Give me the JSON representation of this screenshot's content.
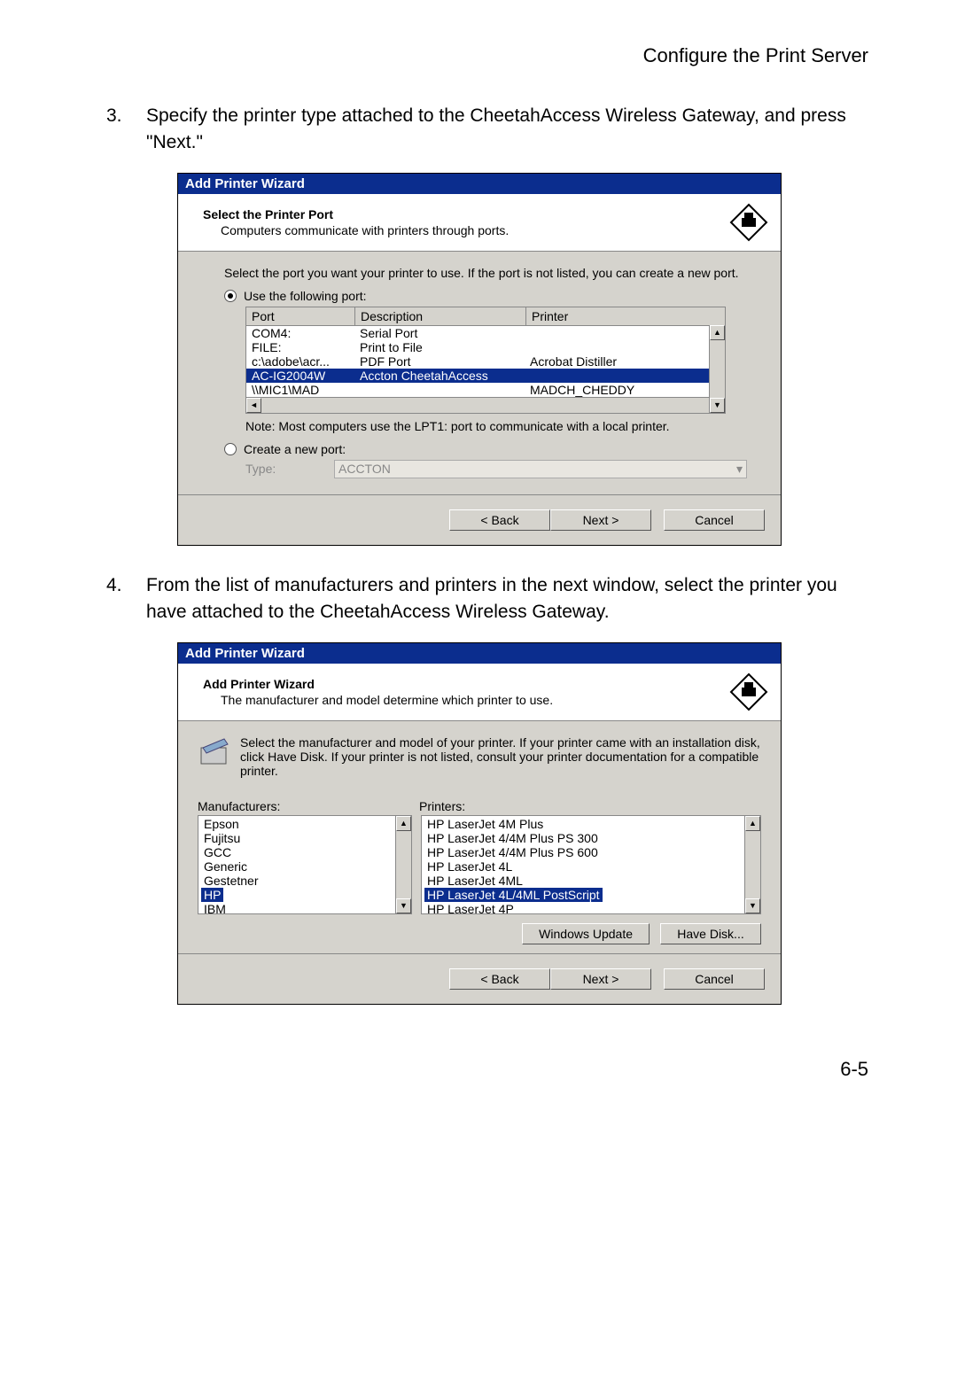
{
  "header": "Configure the Print Server",
  "pageNumber": "6-5",
  "step3": {
    "num": "3.",
    "text": "Specify the printer type attached to the CheetahAccess Wireless Gateway, and press \"Next.\""
  },
  "step4": {
    "num": "4.",
    "text": "From the list of manufacturers and printers in the next window, select the printer you have attached to the CheetahAccess Wireless Gateway."
  },
  "wizard1": {
    "title": "Add Printer Wizard",
    "headTitle": "Select the Printer Port",
    "headSub": "Computers communicate with printers through ports.",
    "intro": "Select the port you want your printer to use.  If the port is not listed, you can create a new port.",
    "radioUse": "Use the following port:",
    "radioCreate": "Create a new port:",
    "cols": {
      "port": "Port",
      "desc": "Description",
      "printer": "Printer"
    },
    "rows": [
      {
        "port": "COM4:",
        "desc": "Serial Port",
        "printer": ""
      },
      {
        "port": "FILE:",
        "desc": "Print to File",
        "printer": ""
      },
      {
        "port": "c:\\adobe\\acr...",
        "desc": "PDF Port",
        "printer": "Acrobat Distiller"
      },
      {
        "port": "AC-IG2004W",
        "desc": "Accton CheetahAccess",
        "printer": "",
        "selected": true
      },
      {
        "port": "\\\\MIC1\\MAD",
        "desc": "",
        "printer": "MADCH_CHEDDY"
      }
    ],
    "note": "Note: Most computers use the LPT1: port to communicate with a local printer.",
    "typeLabel": "Type:",
    "typeValue": "ACCTON",
    "back": "< Back",
    "next": "Next >",
    "cancel": "Cancel"
  },
  "wizard2": {
    "title": "Add Printer Wizard",
    "headTitle": "Add Printer Wizard",
    "headSub": "The manufacturer and model determine which printer to use.",
    "intro": "Select the manufacturer and model of your printer. If your printer came with an installation disk, click Have Disk. If your printer is not listed, consult your printer documentation for a compatible printer.",
    "mfLabel": "Manufacturers:",
    "prLabel": "Printers:",
    "manufacturers": [
      "Epson",
      "Fujitsu",
      "GCC",
      "Generic",
      "Gestetner",
      "HP",
      "IBM"
    ],
    "manufacturerSelected": "HP",
    "printers": [
      "HP LaserJet 4M Plus",
      "HP LaserJet 4/4M Plus PS 300",
      "HP LaserJet 4/4M Plus PS 600",
      "HP LaserJet 4L",
      "HP LaserJet 4ML",
      "HP LaserJet 4L/4ML PostScript",
      "HP LaserJet 4P"
    ],
    "printerSelected": "HP LaserJet 4L/4ML PostScript",
    "winUpdate": "Windows Update",
    "haveDisk": "Have Disk...",
    "back": "< Back",
    "next": "Next >",
    "cancel": "Cancel"
  }
}
